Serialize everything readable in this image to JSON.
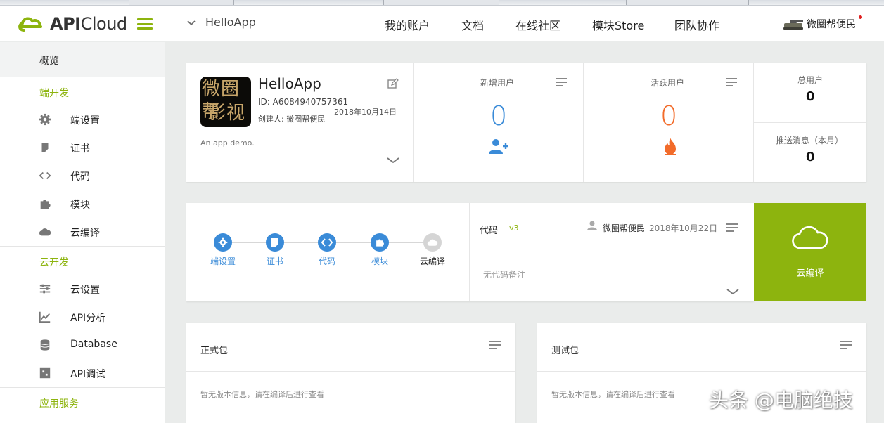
{
  "brand": {
    "logo_text_bold": "API",
    "logo_text": "Cloud",
    "accent": "#8db40e"
  },
  "header": {
    "app_switch": "HelloApp",
    "nav": [
      "我的账户",
      "文档",
      "在线社区",
      "模块Store",
      "团队协作"
    ],
    "user_name": "微圈帮便民"
  },
  "sidebar": {
    "overview": "概览",
    "sections": [
      {
        "title": "端开发",
        "items": [
          {
            "label": "端设置",
            "icon": "gear-icon"
          },
          {
            "label": "证书",
            "icon": "certificate-icon"
          },
          {
            "label": "代码",
            "icon": "code-icon"
          },
          {
            "label": "模块",
            "icon": "puzzle-icon"
          },
          {
            "label": "云编译",
            "icon": "cloud-icon"
          }
        ]
      },
      {
        "title": "云开发",
        "items": [
          {
            "label": "云设置",
            "icon": "sliders-icon"
          },
          {
            "label": "API分析",
            "icon": "chart-icon"
          },
          {
            "label": "Database",
            "icon": "database-icon"
          },
          {
            "label": "API调试",
            "icon": "debug-icon"
          }
        ]
      },
      {
        "title": "应用服务",
        "items": []
      }
    ]
  },
  "app_info": {
    "thumb_text": [
      "微圈帮",
      "影视"
    ],
    "name": "HelloApp",
    "id": "ID: A6084940757361",
    "creator": "创建人: 微圈帮便民",
    "date": "2018年10月14日",
    "description": "An app demo."
  },
  "stats": {
    "new_users_label": "新增用户",
    "new_users": "0",
    "new_users_color": "#3a8bd8",
    "active_users_label": "活跃用户",
    "active_users": "0",
    "active_users_color": "#f26b2a",
    "total_users_label": "总用户",
    "total_users": "0",
    "push_label": "推送消息（本月）",
    "push": "0"
  },
  "steps": [
    {
      "label": "端设置",
      "icon": "gear-icon",
      "done": true
    },
    {
      "label": "证书",
      "icon": "certificate-icon",
      "done": true
    },
    {
      "label": "代码",
      "icon": "code-icon",
      "done": true
    },
    {
      "label": "模块",
      "icon": "puzzle-icon",
      "done": true
    },
    {
      "label": "云编译",
      "icon": "cloud-icon",
      "done": false
    }
  ],
  "code": {
    "title": "代码",
    "version": "v3",
    "user": "微圈帮便民",
    "date": "2018年10月22日",
    "note": "无代码备注"
  },
  "compile_button": {
    "label": "云编译"
  },
  "packages": {
    "release": {
      "title": "正式包",
      "note": "暂无版本信息，请在编译后进行查看"
    },
    "test": {
      "title": "测试包",
      "note": "暂无版本信息，请在编译后进行查看"
    }
  },
  "watermark": "头条 @电脑绝技"
}
